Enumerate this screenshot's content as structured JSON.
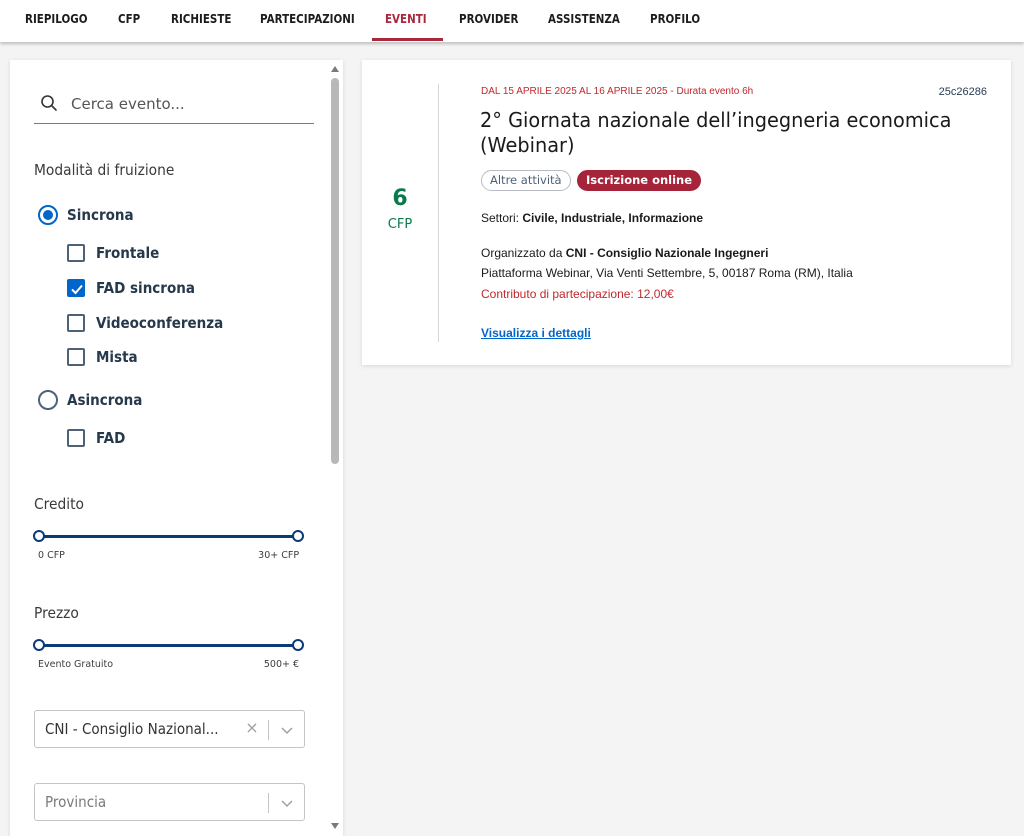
{
  "nav": {
    "items": [
      "RIEPILOGO",
      "CFP",
      "RICHIESTE",
      "PARTECIPAZIONI",
      "EVENTI",
      "PROVIDER",
      "ASSISTENZA",
      "PROFILO"
    ],
    "active": "EVENTI",
    "accent_color": "#a8283c"
  },
  "filters": {
    "search_placeholder": "Cerca evento...",
    "modalita_title": "Modalità di fruizione",
    "sincrona": {
      "label": "Sincrona",
      "selected": true,
      "options": [
        {
          "label": "Frontale",
          "checked": false
        },
        {
          "label": "FAD sincrona",
          "checked": true
        },
        {
          "label": "Videoconferenza",
          "checked": false
        },
        {
          "label": "Mista",
          "checked": false
        }
      ]
    },
    "asincrona": {
      "label": "Asincrona",
      "selected": false,
      "options": [
        {
          "label": "FAD",
          "checked": false
        }
      ]
    },
    "credito": {
      "title": "Credito",
      "min_label": "0 CFP",
      "max_label": "30+ CFP",
      "range": [
        0,
        1
      ]
    },
    "prezzo": {
      "title": "Prezzo",
      "min_label": "Evento Gratuito",
      "max_label": "500+ €",
      "range": [
        0,
        1
      ]
    },
    "provider_select": {
      "value": "CNI - Consiglio Nazional..."
    },
    "provincia_select": {
      "placeholder": "Provincia"
    }
  },
  "event": {
    "cfp_value": "6",
    "cfp_label": "CFP",
    "date_line": "DAL 15 APRILE 2025 AL 16 APRILE 2025 - Durata evento 6h",
    "code": "25c26286",
    "title": "2° Giornata nazionale dell’ingegneria economica (Webinar)",
    "tags": [
      "Altre attività",
      "Iscrizione online"
    ],
    "settori_label": "Settori:",
    "settori_value": "Civile, Industriale, Informazione",
    "organizzato_label": "Organizzato da",
    "organizzato_value": "CNI - Consiglio Nazionale Ingegneri",
    "address": "Piattaforma Webinar, Via Venti Settembre, 5, 00187 Roma (RM), Italia",
    "contributo": "Contributo di partecipazione: 12,00€",
    "details_link": "Visualizza i dettagli"
  },
  "icons": {
    "search": "search-icon",
    "clear": "close-icon",
    "dropdown": "chevron-down-icon",
    "checked": "check-icon"
  }
}
